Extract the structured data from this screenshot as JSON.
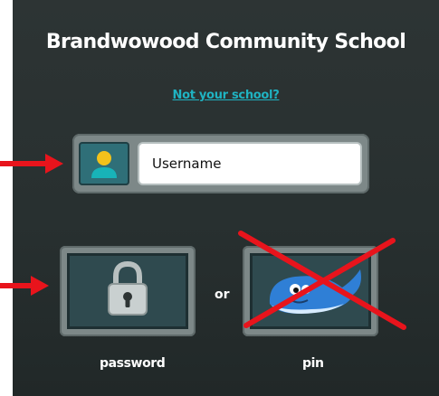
{
  "school": {
    "name": "Brandwowood Community School",
    "change_link": "Not your school?"
  },
  "login": {
    "username_placeholder": "Username",
    "username_value": "",
    "separator": "or",
    "options": [
      {
        "label": "password",
        "icon": "padlock-icon"
      },
      {
        "label": "pin",
        "icon": "whale-icon"
      }
    ]
  },
  "annotations": {
    "arrow_color": "#e8141c",
    "cross_color": "#e8141c"
  },
  "colors": {
    "panel_bg": "#283030",
    "link": "#1fb3c2",
    "tile_frame": "#7d8888",
    "tile_bg": "#2f4a4f",
    "user_icon_bg": "#2f6f78"
  }
}
